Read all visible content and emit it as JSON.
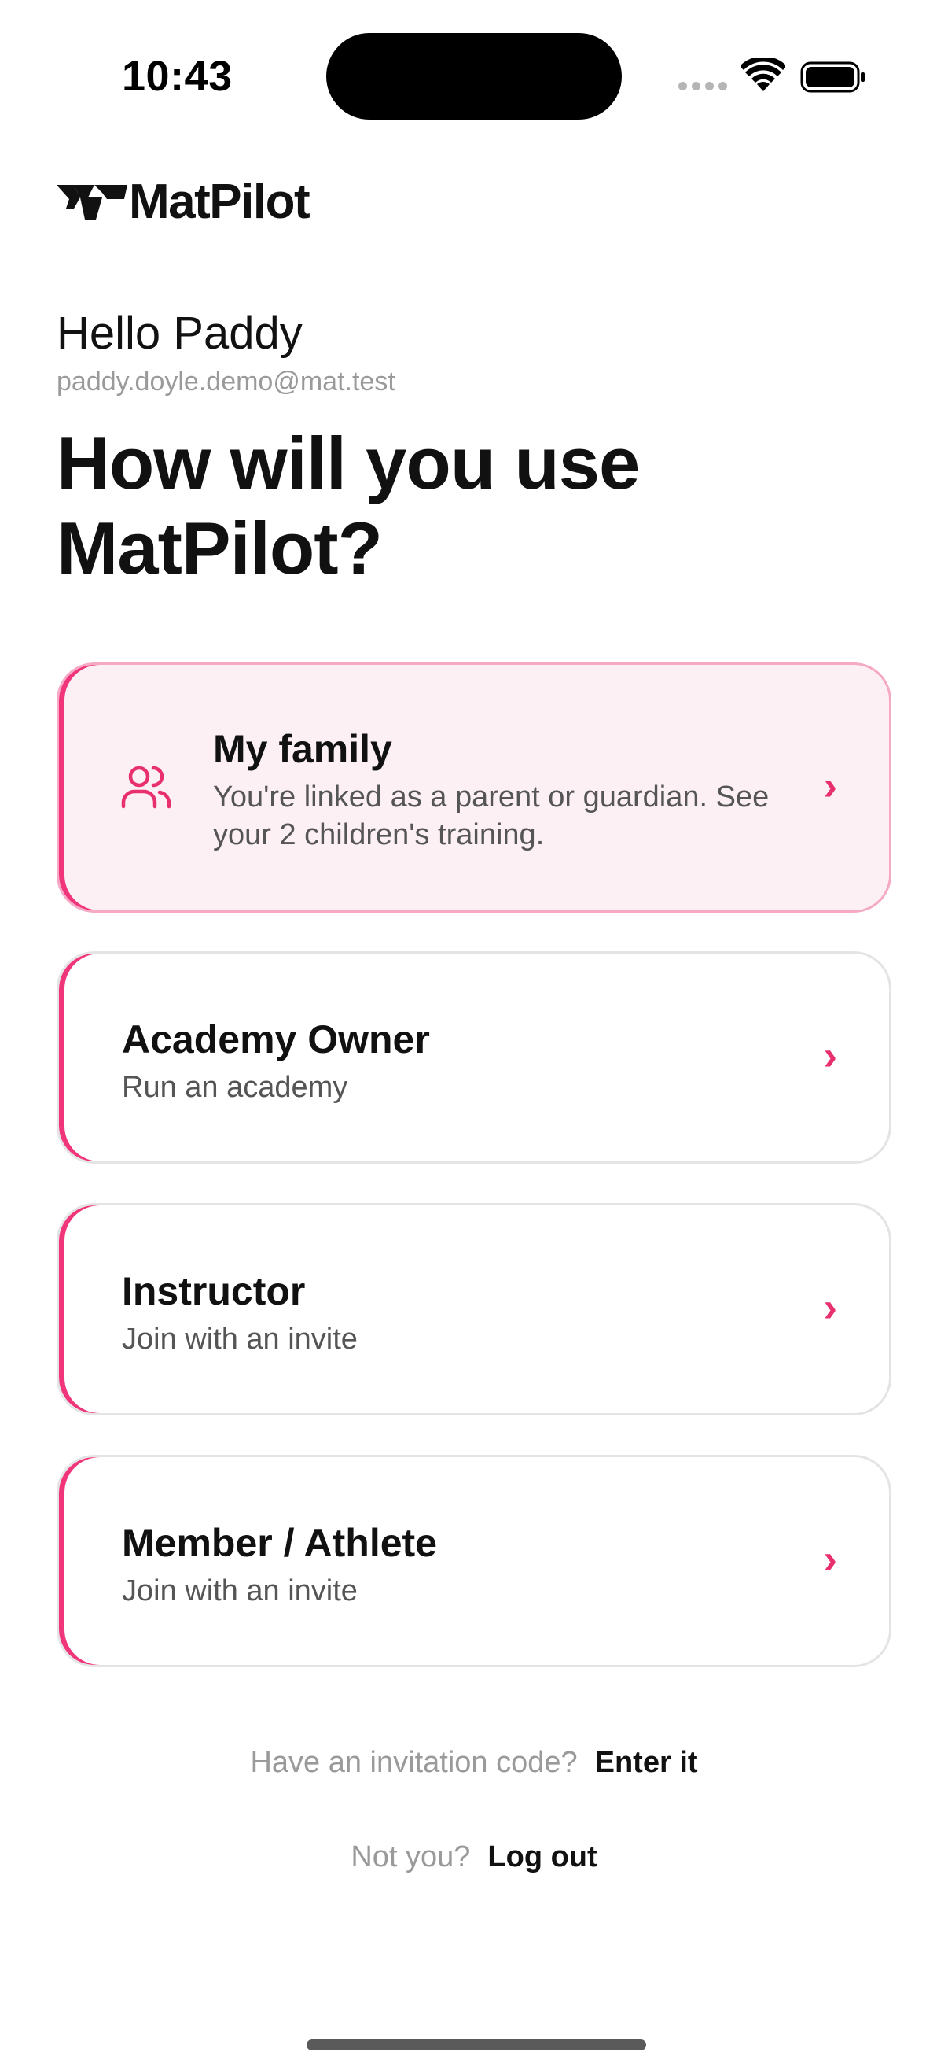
{
  "status_bar": {
    "time": "10:43"
  },
  "brand": {
    "name": "MatPilot",
    "accent": "#f0357a"
  },
  "user": {
    "greeting": "Hello Paddy",
    "email": "paddy.doyle.demo@mat.test"
  },
  "headline": "How will you use MatPilot?",
  "options": [
    {
      "title": "My family",
      "subtitle": "You're linked as a parent or guardian. See your 2 children's training.",
      "icon": "users-icon",
      "selected": true
    },
    {
      "title": "Academy Owner",
      "subtitle": "Run an academy",
      "selected": false
    },
    {
      "title": "Instructor",
      "subtitle": "Join with an invite",
      "selected": false
    },
    {
      "title": "Member / Athlete",
      "subtitle": "Join with an invite",
      "selected": false
    }
  ],
  "chevron": "›",
  "invitation": {
    "prompt": "Have an invitation code?",
    "action": "Enter it"
  },
  "logout": {
    "prompt": "Not you?",
    "action": "Log out"
  }
}
